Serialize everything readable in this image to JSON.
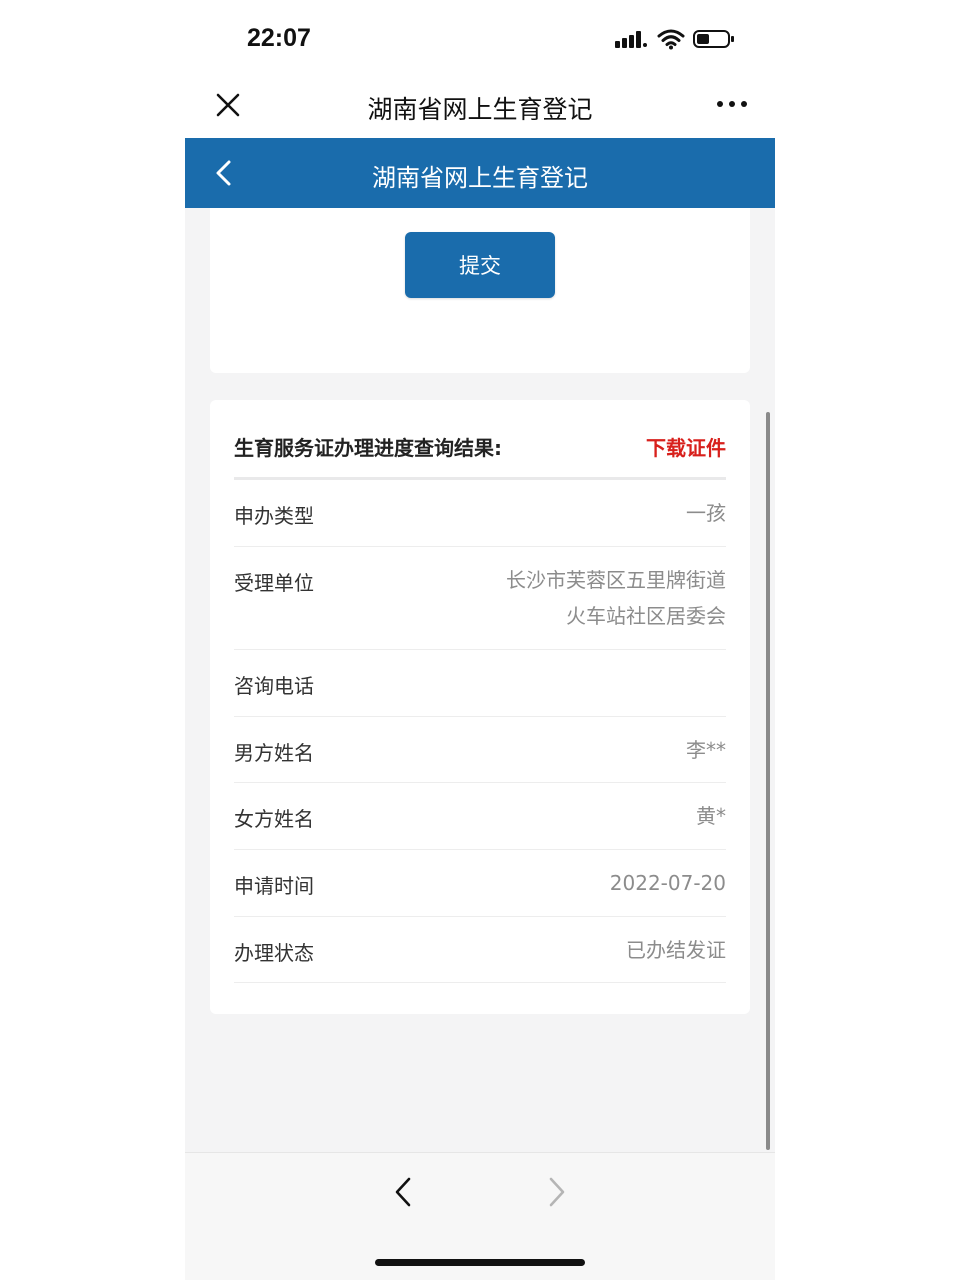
{
  "status_bar": {
    "time": "22:07"
  },
  "wechat_bar": {
    "title": "湖南省网上生育登记"
  },
  "app_header": {
    "title": "湖南省网上生育登记"
  },
  "form": {
    "submit_label": "提交"
  },
  "result": {
    "title": "生育服务证办理进度查询结果:",
    "download_label": "下载证件",
    "rows": [
      {
        "label": "申办类型",
        "value": "一孩"
      },
      {
        "label": "受理单位",
        "value_line1": "长沙市芙蓉区五里牌街道",
        "value_line2": "火车站社区居委会"
      },
      {
        "label": "咨询电话",
        "value": ""
      },
      {
        "label": "男方姓名",
        "value": "李**"
      },
      {
        "label": "女方姓名",
        "value": "黄*"
      },
      {
        "label": "申请时间",
        "value": "2022-07-20"
      },
      {
        "label": "办理状态",
        "value": "已办结发证"
      }
    ]
  },
  "icons": {
    "close": "close-icon",
    "more": "more-dots-icon",
    "back": "chevron-left-icon",
    "nav_back": "chevron-left-icon",
    "nav_forward": "chevron-right-icon"
  },
  "colors": {
    "brand": "#1a6cac",
    "download": "#d8201c"
  }
}
